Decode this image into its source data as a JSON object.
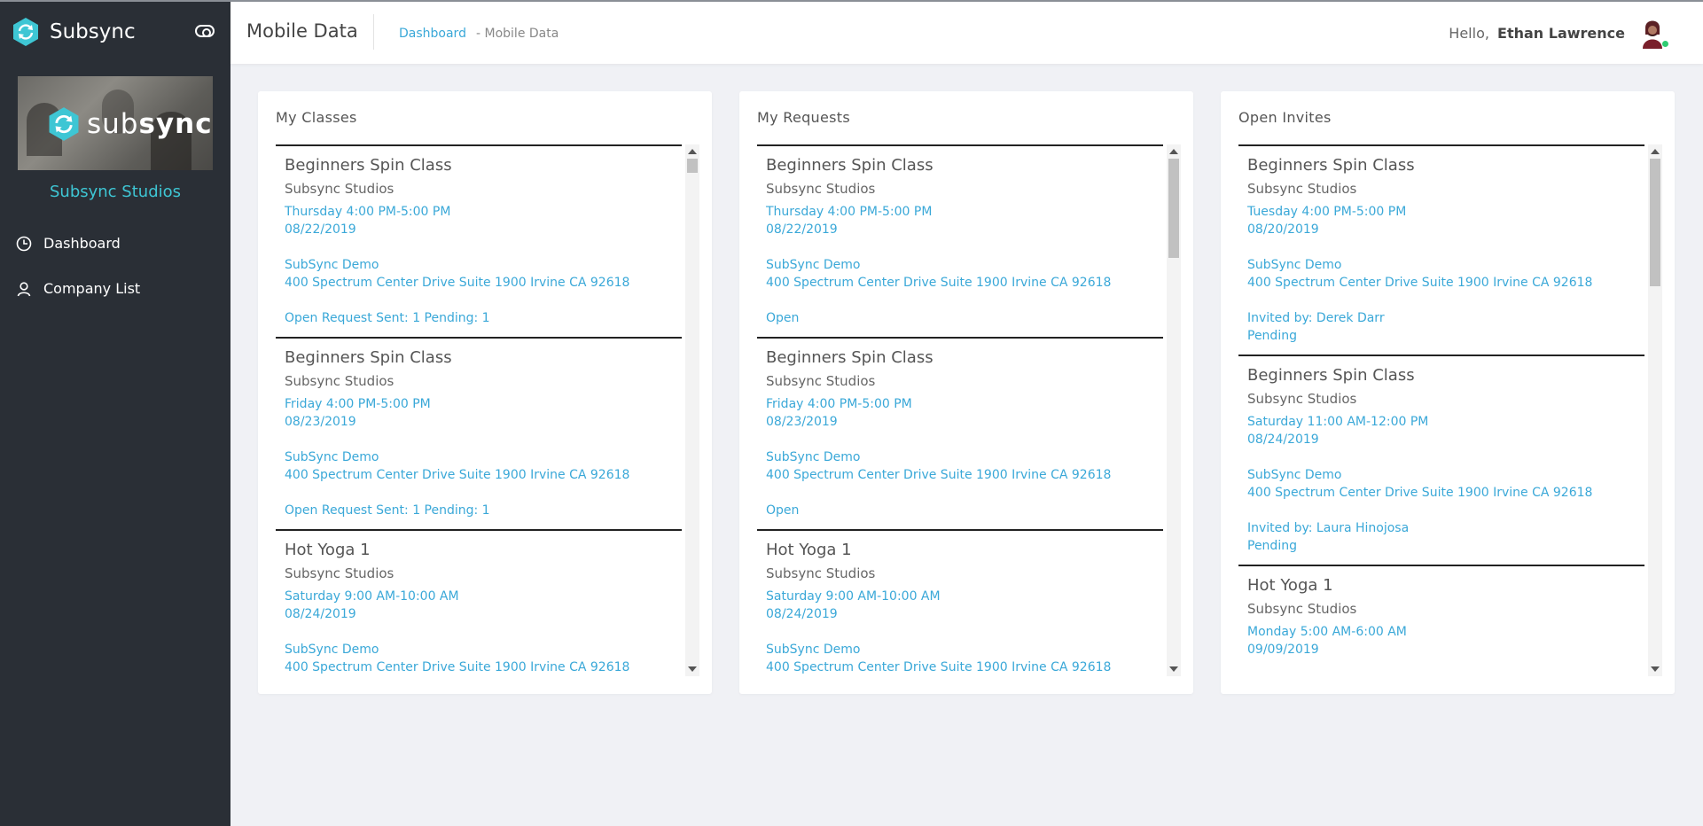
{
  "app": {
    "name": "Subsync",
    "banner_text_light": "sub",
    "banner_text_bold": "sync",
    "studio_name": "Subsync Studios"
  },
  "sidebar": {
    "items": [
      {
        "label": "Dashboard",
        "icon": "clock-icon"
      },
      {
        "label": "Company List",
        "icon": "user-icon"
      }
    ]
  },
  "header": {
    "title": "Mobile Data",
    "breadcrumb_home": "Dashboard",
    "breadcrumb_current": "- Mobile Data",
    "greeting": "Hello,",
    "user_name": "Ethan Lawrence"
  },
  "colors": {
    "sidebar_bg": "#2a2f36",
    "accent_teal": "#3ec6d4",
    "link_blue": "#3aa8d8"
  },
  "cards": [
    {
      "title": "My Classes",
      "items": [
        {
          "title": "Beginners Spin Class",
          "studio": "Subsync Studios",
          "time": "Thursday 4:00 PM-5:00 PM",
          "date": "08/22/2019",
          "company": "SubSync Demo",
          "address": "400 Spectrum Center Drive Suite 1900 Irvine CA 92618",
          "status": "Open Request Sent: 1 Pending: 1",
          "status2": ""
        },
        {
          "title": "Beginners Spin Class",
          "studio": "Subsync Studios",
          "time": "Friday 4:00 PM-5:00 PM",
          "date": "08/23/2019",
          "company": "SubSync Demo",
          "address": "400 Spectrum Center Drive Suite 1900 Irvine CA 92618",
          "status": "Open Request Sent: 1 Pending: 1",
          "status2": ""
        },
        {
          "title": "Hot Yoga 1",
          "studio": "Subsync Studios",
          "time": "Saturday 9:00 AM-10:00 AM",
          "date": "08/24/2019",
          "company": "SubSync Demo",
          "address": "400 Spectrum Center Drive Suite 1900 Irvine CA 92618",
          "status": "",
          "status2": ""
        }
      ]
    },
    {
      "title": "My Requests",
      "items": [
        {
          "title": "Beginners Spin Class",
          "studio": "Subsync Studios",
          "time": "Thursday 4:00 PM-5:00 PM",
          "date": "08/22/2019",
          "company": "SubSync Demo",
          "address": "400 Spectrum Center Drive Suite 1900 Irvine CA 92618",
          "status": "Open",
          "status2": ""
        },
        {
          "title": "Beginners Spin Class",
          "studio": "Subsync Studios",
          "time": "Friday 4:00 PM-5:00 PM",
          "date": "08/23/2019",
          "company": "SubSync Demo",
          "address": "400 Spectrum Center Drive Suite 1900 Irvine CA 92618",
          "status": "Open",
          "status2": ""
        },
        {
          "title": "Hot Yoga 1",
          "studio": "Subsync Studios",
          "time": "Saturday 9:00 AM-10:00 AM",
          "date": "08/24/2019",
          "company": "SubSync Demo",
          "address": "400 Spectrum Center Drive Suite 1900 Irvine CA 92618",
          "status": "",
          "status2": ""
        }
      ]
    },
    {
      "title": "Open Invites",
      "items": [
        {
          "title": "Beginners Spin Class",
          "studio": "Subsync Studios",
          "time": "Tuesday 4:00 PM-5:00 PM",
          "date": "08/20/2019",
          "company": "SubSync Demo",
          "address": "400 Spectrum Center Drive Suite 1900 Irvine CA 92618",
          "status": "Invited by: Derek Darr",
          "status2": "Pending"
        },
        {
          "title": "Beginners Spin Class",
          "studio": "Subsync Studios",
          "time": "Saturday 11:00 AM-12:00 PM",
          "date": "08/24/2019",
          "company": "SubSync Demo",
          "address": "400 Spectrum Center Drive Suite 1900 Irvine CA 92618",
          "status": "Invited by: Laura Hinojosa",
          "status2": "Pending"
        },
        {
          "title": "Hot Yoga 1",
          "studio": "Subsync Studios",
          "time": "Monday 5:00 AM-6:00 AM",
          "date": "09/09/2019",
          "company": "",
          "address": "",
          "status": "",
          "status2": ""
        }
      ]
    }
  ]
}
